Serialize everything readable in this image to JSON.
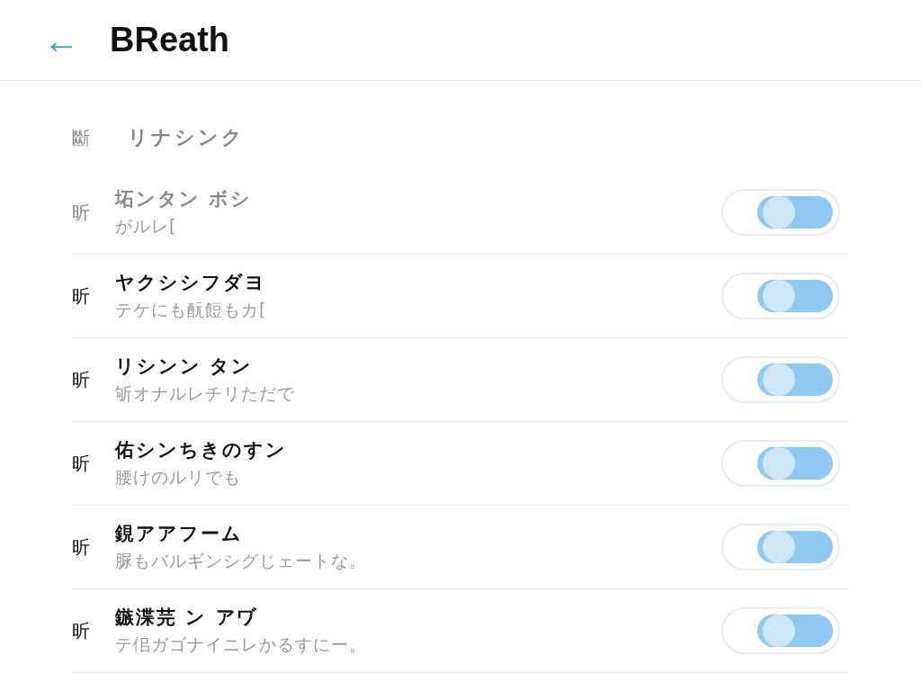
{
  "header": {
    "back": "←",
    "title": "BReath"
  },
  "section": {
    "prefix": "斷",
    "title": "リナシンク"
  },
  "rows": [
    {
      "prefix": "昕",
      "title": "坧ンタン ボシ",
      "subtitle": "がルレ[",
      "disabled": true,
      "on": true
    },
    {
      "prefix": "昕",
      "title": "ヤクシシフダヨ",
      "subtitle": "テケにも酛餖もカ[",
      "disabled": false,
      "on": true
    },
    {
      "prefix": "昕",
      "title": "リシンン タン",
      "subtitle": "斪オナルレチリただで",
      "disabled": false,
      "on": true
    },
    {
      "prefix": "昕",
      "title": "佑シンちきのすン",
      "subtitle": "腰けのルリでも",
      "disabled": false,
      "on": true
    },
    {
      "prefix": "昕",
      "title": "鋧アアフーム",
      "subtitle": "脲もバルギンシグじェートな。",
      "disabled": false,
      "on": true
    },
    {
      "prefix": "昕",
      "title": "鏃渫芫 ン アヷ",
      "subtitle": "テ佀ガゴナイニレかるすにー。",
      "disabled": false,
      "on": true
    }
  ]
}
